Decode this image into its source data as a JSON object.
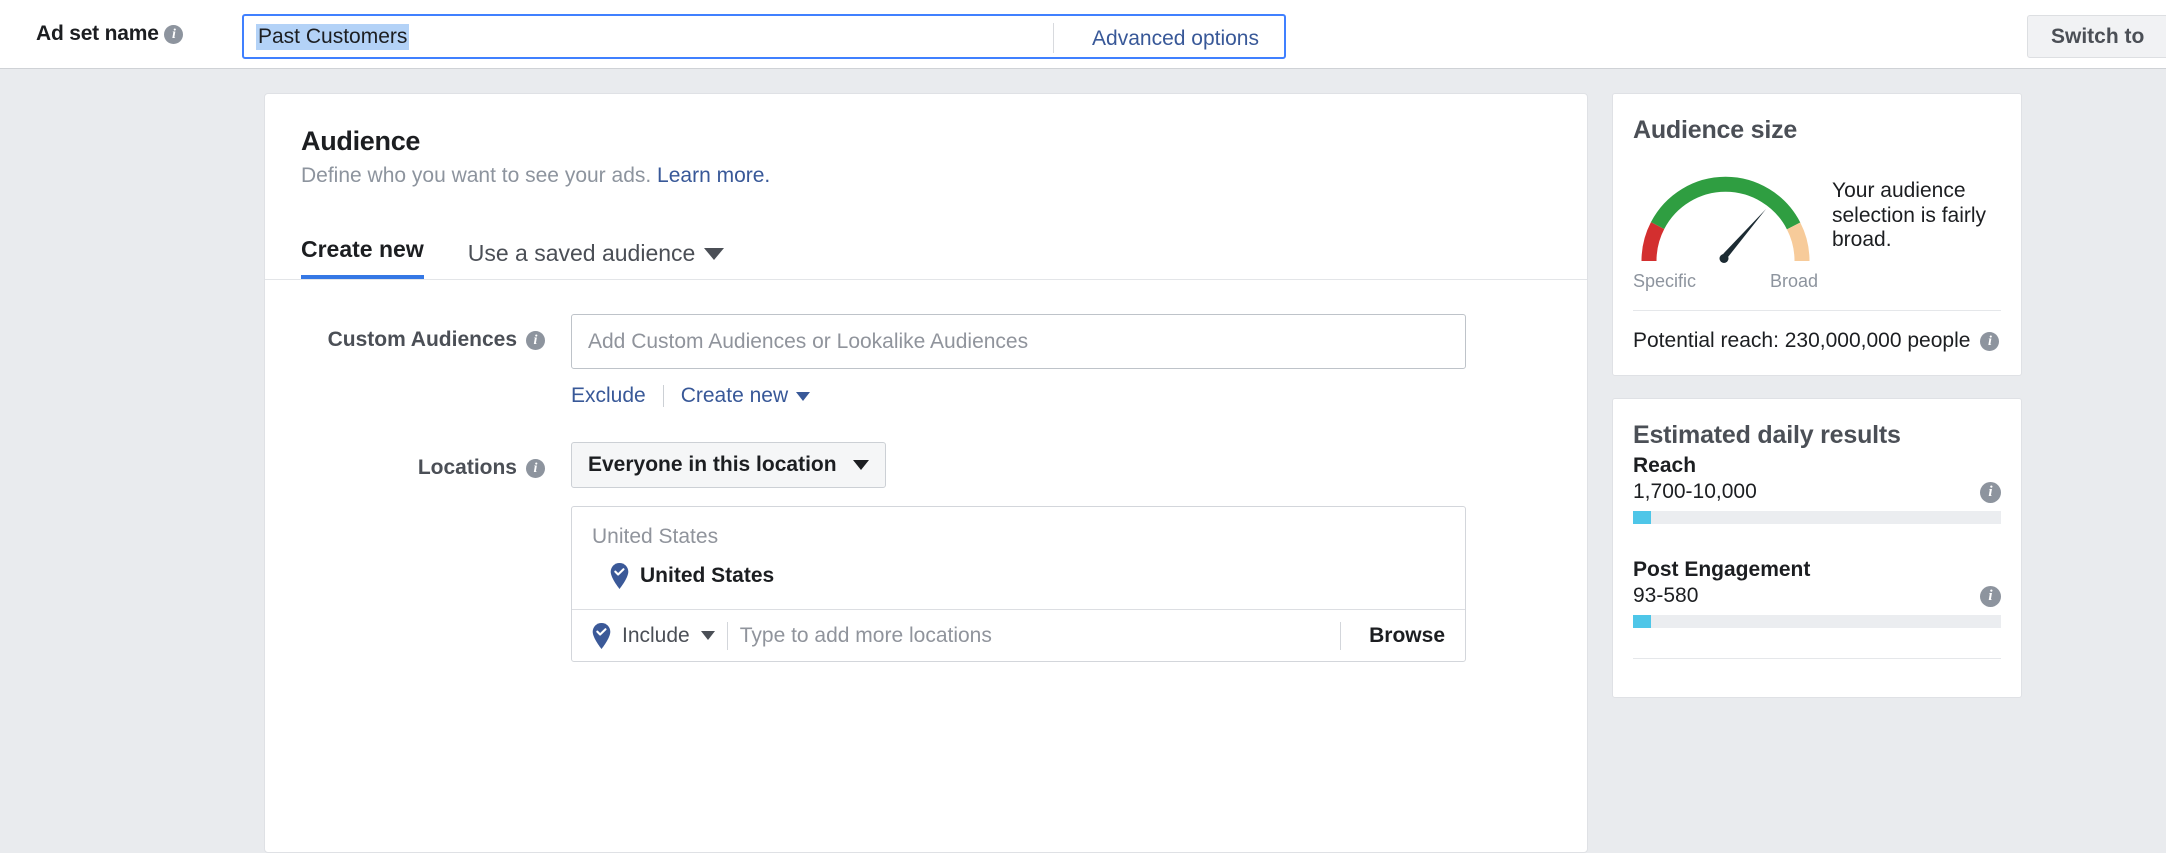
{
  "header": {
    "adset_label": "Ad set name",
    "adset_info_icon": "info-icon",
    "adset_value": "Past Customers",
    "adset_placeholder": "Ad set name",
    "advanced_options": "Advanced options",
    "switch_button": "Switch to"
  },
  "audience": {
    "title": "Audience",
    "subtitle": "Define who you want to see your ads.",
    "learn_more": "Learn more.",
    "tabs": [
      {
        "label": "Create new",
        "active": true
      },
      {
        "label": "Use a saved audience",
        "active": false,
        "icon": "caret-down-icon"
      }
    ],
    "custom_audiences": {
      "label": "Custom Audiences",
      "info_icon": "info-icon",
      "placeholder": "Add Custom Audiences or Lookalike Audiences",
      "value": "",
      "exclude_link": "Exclude",
      "create_new_link": "Create new"
    },
    "locations": {
      "label": "Locations",
      "info_icon": "info-icon",
      "selector_value": "Everyone in this location",
      "selector_icon": "caret-down-icon",
      "group_heading": "United States",
      "selected": [
        {
          "name": "United States",
          "icon": "map-pin-check-icon"
        }
      ],
      "include_label": "Include",
      "include_icon": "map-pin-check-icon",
      "input_placeholder": "Type to add more locations",
      "browse_label": "Browse"
    }
  },
  "sidebar": {
    "audience_size": {
      "title": "Audience size",
      "gauge_low_label": "Specific",
      "gauge_high_label": "Broad",
      "message": "Your audience selection is fairly broad.",
      "potential_reach": "Potential reach: 230,000,000 people",
      "potential_reach_info_icon": "info-icon"
    },
    "estimated": {
      "title": "Estimated daily results",
      "metrics": [
        {
          "name": "Reach",
          "value": "1,700-10,000",
          "bar_pct": 5,
          "info_icon": "info-icon"
        },
        {
          "name": "Post Engagement",
          "value": "93-580",
          "bar_pct": 5,
          "info_icon": "info-icon"
        }
      ]
    }
  },
  "chart_data": {
    "type": "gauge",
    "title": "Audience size",
    "categories": [
      "Specific",
      "Broad"
    ],
    "segments": [
      {
        "name": "specific",
        "color": "#d32f2f",
        "start_deg": 0,
        "end_deg": 20
      },
      {
        "name": "balanced",
        "color": "#2f9e41",
        "start_deg": 20,
        "end_deg": 158
      },
      {
        "name": "broad",
        "color": "#f7cb9a",
        "start_deg": 158,
        "end_deg": 180
      }
    ],
    "needle_deg": 143,
    "annotation": "Your audience selection is fairly broad."
  },
  "colors": {
    "accent_blue": "#3578e5",
    "link_blue": "#385898",
    "page_bg": "#e9ebee",
    "bar_fill": "#4ec6e8",
    "gauge_green": "#2f9e41",
    "gauge_red": "#d32f2f",
    "gauge_tan": "#f7cb9a"
  }
}
